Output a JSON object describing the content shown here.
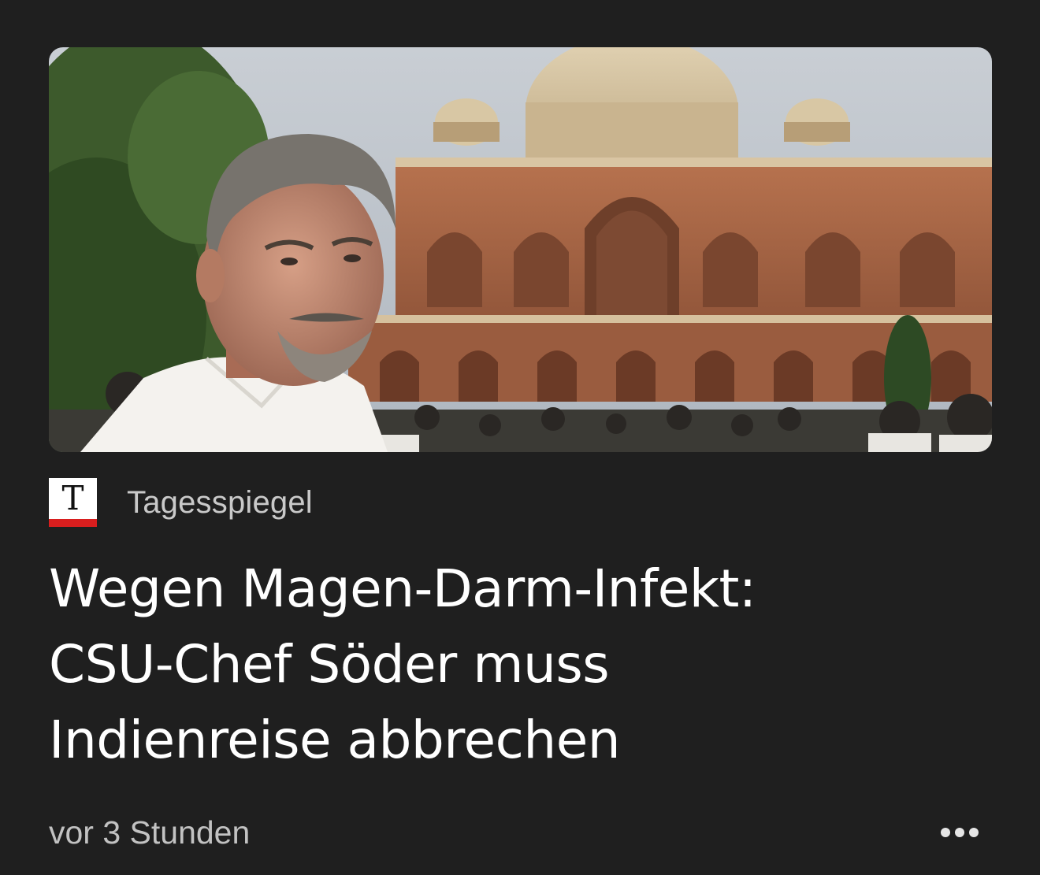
{
  "article": {
    "image_alt": "Markus Söder vor Humayun-Mausoleum in Delhi",
    "publisher": {
      "logo_letter": "T",
      "name": "Tagesspiegel"
    },
    "headline_lines": [
      "Wegen Magen-Darm-Infekt:",
      "CSU-Chef Söder muss",
      "Indienreise abbrechen"
    ],
    "timestamp": "vor 3 Stunden",
    "more_icon": "more-horizontal-icon"
  },
  "colors": {
    "background": "#1f1f1f",
    "headline": "#ffffff",
    "secondary_text": "#c2c2c2",
    "logo_accent": "#d81e1e"
  }
}
